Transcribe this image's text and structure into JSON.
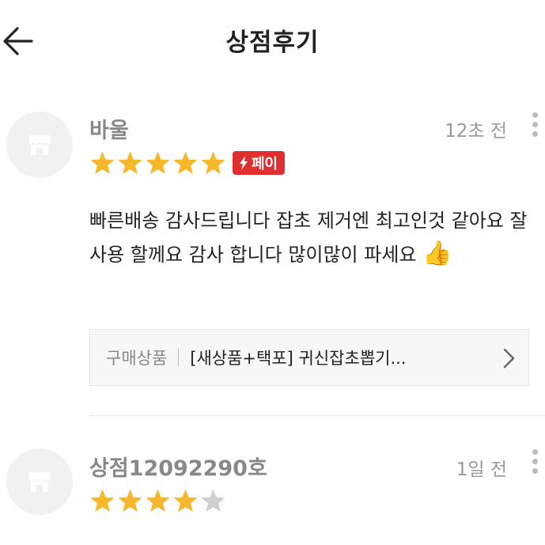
{
  "header": {
    "title": "상점후기"
  },
  "reviews": [
    {
      "author": "바울",
      "time": "12초 전",
      "rating": 5,
      "max_rating": 5,
      "pay_badge": "페이",
      "text": "빠른배송 감사드립니다  잡초 제거엔 최고인것 같아요 잘 사용 할께요 감사 합니다 많이많이 파세요",
      "emoji": "👍",
      "product_label": "구매상품",
      "product_name": "[새상품+택포] 귀신잡초뽑기..."
    },
    {
      "author": "상점12092290호",
      "time": "1일 전",
      "rating": 4,
      "max_rating": 5
    }
  ],
  "icons": {
    "back": "arrow-left-icon",
    "avatar": "shop-icon",
    "more": "more-vertical-icon",
    "pay": "lightning-icon",
    "chevron": "chevron-right-icon",
    "star": "star-icon"
  },
  "colors": {
    "star_filled": "#F7B72A",
    "star_empty": "#CFCFCF",
    "pay_badge": "#E12E2E"
  }
}
